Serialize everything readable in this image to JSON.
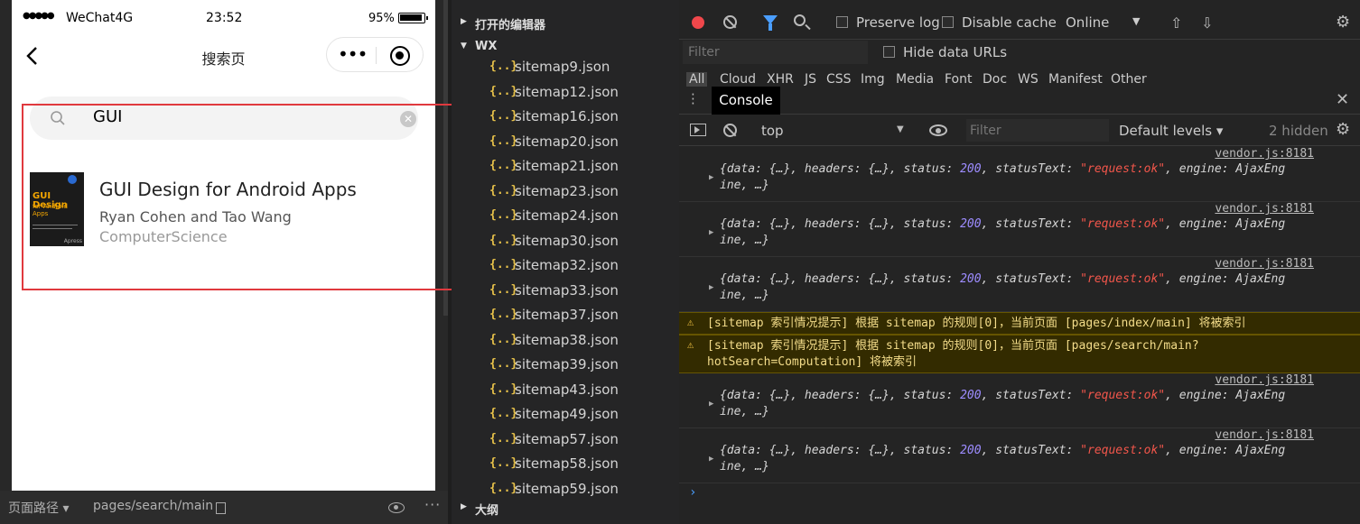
{
  "simulator": {
    "status_bar": {
      "signal": "●●●●●",
      "carrier": "WeChat4G",
      "time": "23:52",
      "battery": "95%"
    },
    "nav_title": "搜索页",
    "capsule_dots": "•••",
    "search": {
      "value": "GUI"
    },
    "result": {
      "cover_title": "GUI Design",
      "cover_subtitle": "for Android Apps",
      "cover_publisher": "Apress",
      "title": "GUI Design for Android Apps",
      "authors": "Ryan Cohen and Tao Wang",
      "category": "ComputerScience"
    },
    "bottom": {
      "path_label": "页面路径 ▾",
      "path_value": "pages/search/main",
      "more": "···"
    }
  },
  "file_tree": {
    "open_editors": "打开的编辑器",
    "folder": "WX",
    "outline": "大纲",
    "file_icon": "{..}",
    "files": [
      "sitemap9.json",
      "sitemap12.json",
      "sitemap16.json",
      "sitemap20.json",
      "sitemap21.json",
      "sitemap23.json",
      "sitemap24.json",
      "sitemap30.json",
      "sitemap32.json",
      "sitemap33.json",
      "sitemap37.json",
      "sitemap38.json",
      "sitemap39.json",
      "sitemap43.json",
      "sitemap49.json",
      "sitemap57.json",
      "sitemap58.json",
      "sitemap59.json"
    ]
  },
  "devtools": {
    "toolbar": {
      "preserve_log": "Preserve log",
      "disable_cache": "Disable cache",
      "throttle": "Online"
    },
    "filter_placeholder": "Filter",
    "hide_data_urls": "Hide data URLs",
    "resource_types": [
      "All",
      "Cloud",
      "XHR",
      "JS",
      "CSS",
      "Img",
      "Media",
      "Font",
      "Doc",
      "WS",
      "Manifest",
      "Other"
    ],
    "tabs": {
      "console": "Console"
    },
    "console_toolbar": {
      "context": "top",
      "filter_placeholder": "Filter",
      "levels": "Default levels ▾",
      "hidden": "2 hidden"
    },
    "console": {
      "source": "vendor.js:8181",
      "log": {
        "p1": "{data: {…}, headers: {…}, status: ",
        "status": "200",
        "p2": ", statusText: ",
        "status_text": "\"request:ok\"",
        "p3": ", engine: AjaxEng",
        "line2": "ine, …}"
      },
      "warnings": [
        "[sitemap 索引情况提示] 根据 sitemap 的规则[0]，当前页面 [pages/index/main] 将被索引",
        "[sitemap 索引情况提示] 根据 sitemap 的规则[0]，当前页面 [pages/search/main?hotSearch=Computation] 将被索引"
      ],
      "prompt": "›"
    }
  }
}
